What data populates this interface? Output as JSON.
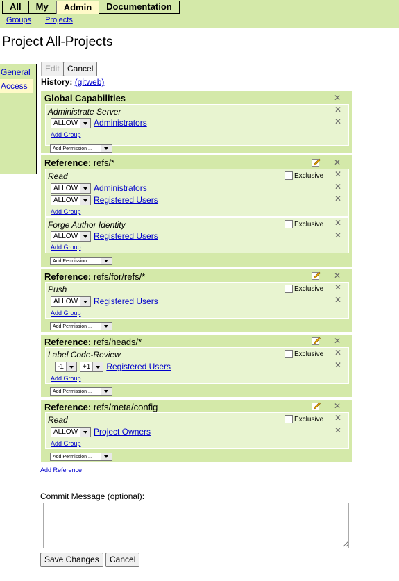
{
  "topmenu": [
    "All",
    "My",
    "Admin",
    "Documentation"
  ],
  "submenu": [
    "Groups",
    "Projects"
  ],
  "page_title": "Project All-Projects",
  "leftnav": [
    "General",
    "Access"
  ],
  "buttons": {
    "edit": "Edit",
    "cancel": "Cancel",
    "save": "Save Changes",
    "cancel2": "Cancel"
  },
  "history": {
    "label": "History:",
    "link": "(gitweb)"
  },
  "text": {
    "allow": "ALLOW",
    "add_group": "Add Group",
    "add_permission": "Add Permission ...",
    "exclusive": "Exclusive",
    "reference_prefix": "Reference:",
    "add_reference": "Add Reference",
    "commit_label": "Commit Message (optional):"
  },
  "global": {
    "title": "Global Capabilities",
    "perm": "Administrate Server",
    "group": "Administrators"
  },
  "ref1": {
    "ref": "refs/*",
    "perm1": "Read",
    "perm1_groups": [
      "Administrators",
      "Registered Users"
    ],
    "perm2": "Forge Author Identity",
    "perm2_group": "Registered Users"
  },
  "ref2": {
    "ref": "refs/for/refs/*",
    "perm": "Push",
    "group": "Registered Users"
  },
  "ref3": {
    "ref": "refs/heads/*",
    "perm": "Label Code-Review",
    "min": "-1",
    "max": "+1",
    "group": "Registered Users"
  },
  "ref4": {
    "ref": "refs/meta/config",
    "perm": "Read",
    "group": "Project Owners"
  }
}
